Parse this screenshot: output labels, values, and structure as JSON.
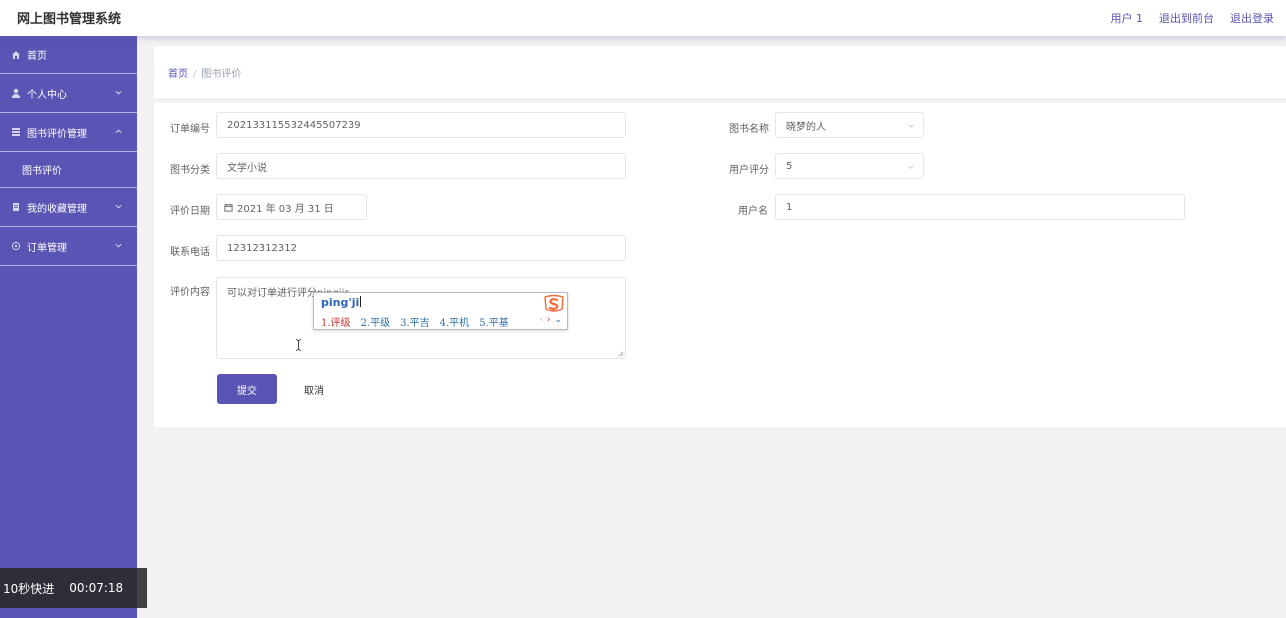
{
  "header": {
    "title": "网上图书管理系统",
    "links": [
      "用户 1",
      "退出到前台",
      "退出登录"
    ]
  },
  "sidebar": {
    "home": "首页",
    "personal": "个人中心",
    "review_mgmt": "图书评价管理",
    "review_sub": "图书评价",
    "favorites_mgmt": "我的收藏管理",
    "order_mgmt": "订单管理"
  },
  "breadcrumb": {
    "home": "首页",
    "sep": "/",
    "current": "图书评价"
  },
  "form": {
    "order_no_label": "订单编号",
    "order_no_value": "202133115532445507239",
    "book_name_label": "图书名称",
    "book_name_value": "晓梦的人",
    "category_label": "图书分类",
    "category_value": "文学小说",
    "rating_label": "用户评分",
    "rating_value": "5",
    "date_label": "评价日期",
    "date_value": "2021 年 03 月 31 日",
    "username_label": "用户名",
    "username_value": "1",
    "phone_label": "联系电话",
    "phone_value": "12312312312",
    "content_label": "评价内容",
    "content_value": "可以对订单进行评分pingjis",
    "submit": "提交",
    "cancel": "取消"
  },
  "ime": {
    "pinyin": "ping'ji",
    "candidates": [
      "1.评级",
      "2.平级",
      "3.平吉",
      "4.平机",
      "5.平基"
    ],
    "nav": [
      "‹",
      "›",
      "⌄"
    ]
  },
  "video": {
    "forward": "10秒快进",
    "time": "00:07:18"
  },
  "colors": {
    "accent": "#5a55b4",
    "ime_selected": "#c4332c",
    "ime_candidate": "#2f6fa8",
    "ime_logo": "#f26b3a"
  }
}
